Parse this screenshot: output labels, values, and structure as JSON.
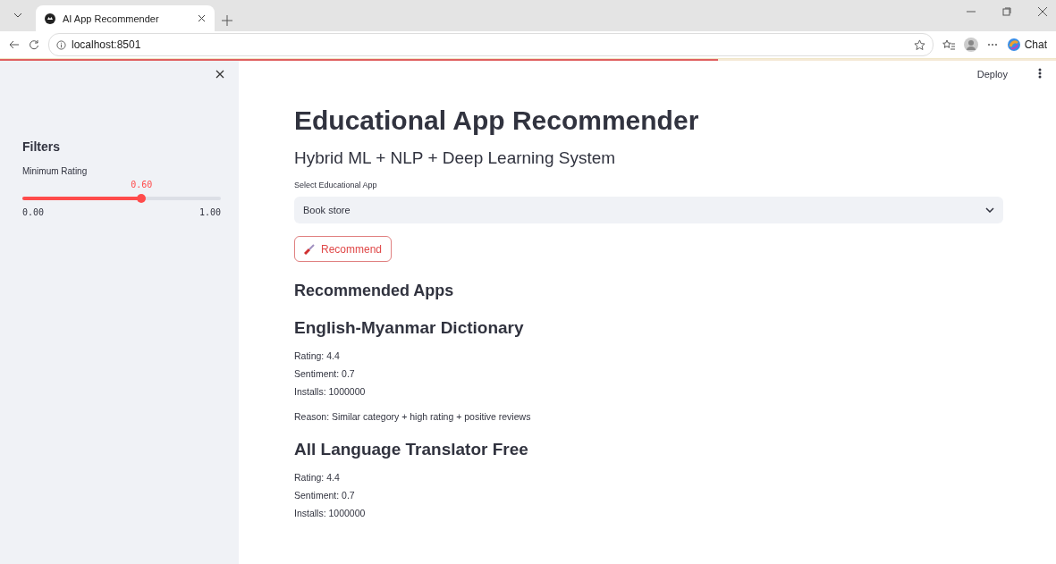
{
  "browser": {
    "tab_title": "AI App Recommender",
    "address": "localhost:8501",
    "chat_label": "Chat"
  },
  "toolbar": {
    "deploy": "Deploy"
  },
  "sidebar": {
    "title": "Filters",
    "slider": {
      "label": "Minimum Rating",
      "reading": "0.60",
      "level": 0.6,
      "min": "0.00",
      "max": "1.00"
    }
  },
  "main": {
    "title": "Educational App Recommender",
    "subtitle": "Hybrid ML + NLP + Deep Learning System",
    "select_label": "Select Educational App",
    "select_value": "Book store",
    "button": "Recommend",
    "section": "Recommended Apps",
    "results": [
      {
        "name": "English-Myanmar Dictionary",
        "lines": [
          "Rating: 4.4",
          "Sentiment: 0.7",
          "Installs: 1000000"
        ],
        "reason": "Reason: Similar category + high rating + positive reviews"
      },
      {
        "name": "All Language Translator Free",
        "lines": [
          "Rating: 4.4",
          "Sentiment: 0.7",
          "Installs: 1000000"
        ]
      }
    ]
  }
}
